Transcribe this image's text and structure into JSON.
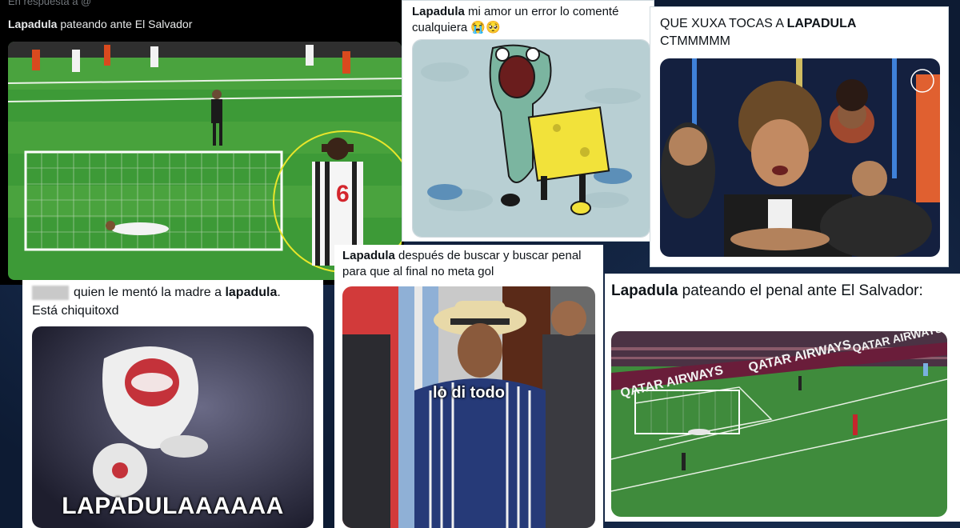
{
  "card1": {
    "reply_line": "En respuesta a @",
    "user": "Lapadula",
    "text": " pateando ante El Salvador",
    "shirt_number": "6"
  },
  "card2": {
    "user": "Lapadula",
    "text": " mi amor un error lo comenté cualquiera 😭🥺"
  },
  "card3": {
    "text_pre": "QUE XUXA TOCAS A ",
    "user": "LAPADULA",
    "text_post": "CTMMMMM"
  },
  "card4": {
    "text_pre": "quien le mentó la madre a ",
    "user": "lapadula",
    "text_post": ".",
    "line2": "Está chiquitoxd",
    "meme_text": "LAPADULAAAAAA"
  },
  "card5": {
    "user": "Lapadula",
    "text": " después de buscar y buscar penal para que al final no meta gol",
    "meme_text": "lo di todo"
  },
  "card6": {
    "user": "Lapadula",
    "text": " pateando el penal ante El Salvador:",
    "ad_text": "QATAR AIRWAYS"
  }
}
